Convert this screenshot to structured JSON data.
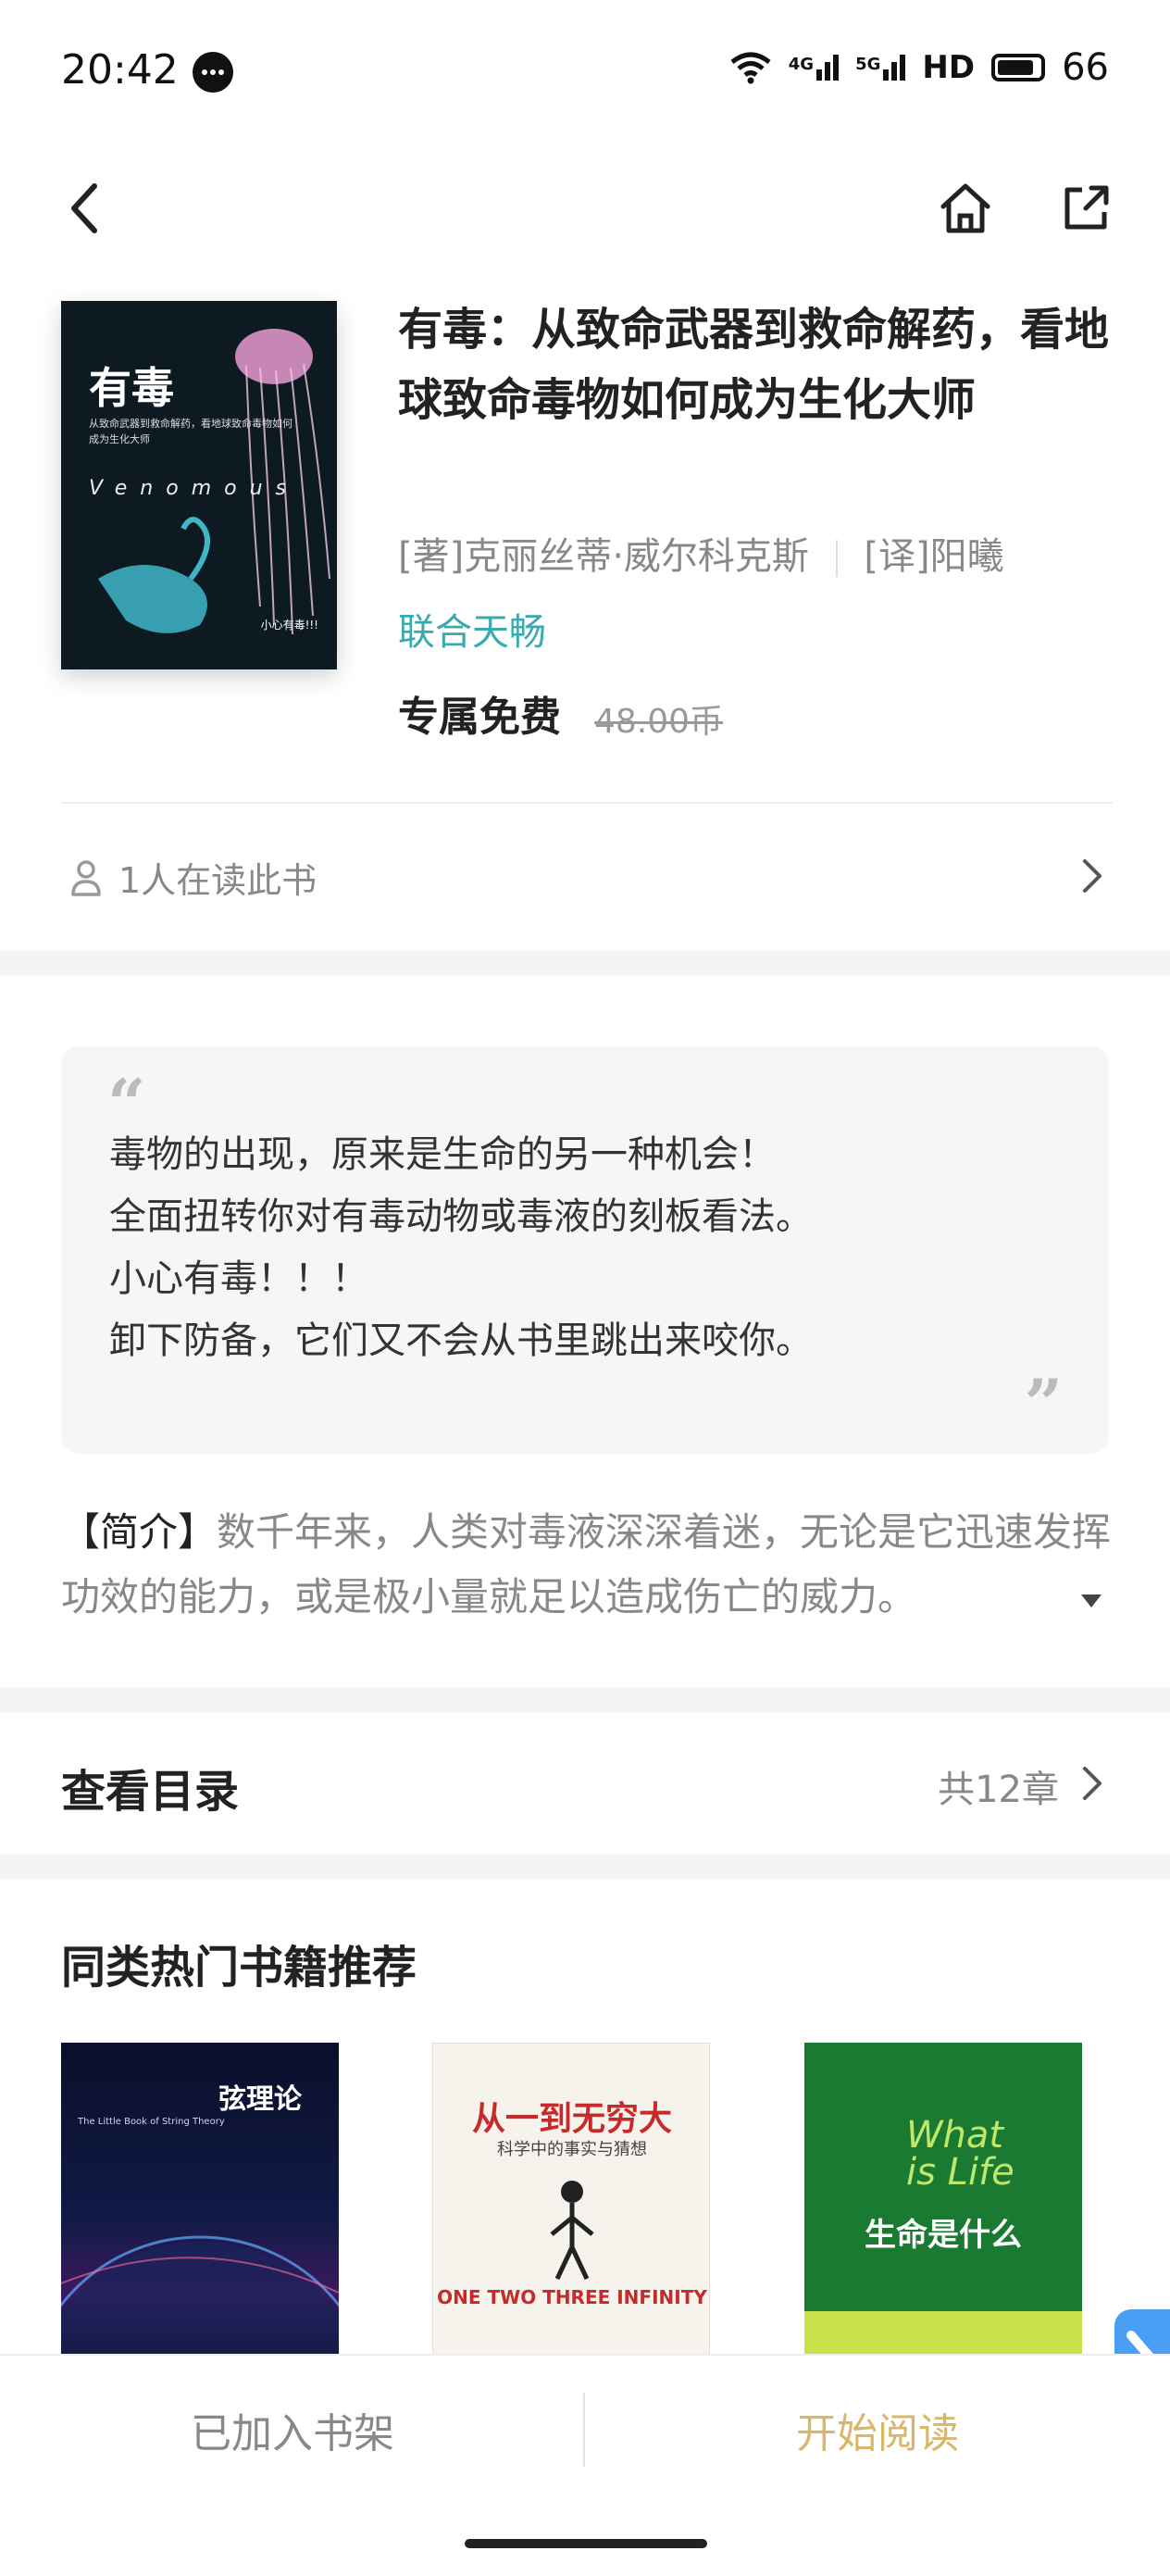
{
  "status_bar": {
    "time": "20:42",
    "network_1": "4G",
    "network_2": "5G",
    "hd": "HD",
    "battery": "66"
  },
  "nav": {
    "back_icon": "chevron-left-icon",
    "home_icon": "home-icon",
    "share_icon": "share-icon"
  },
  "book": {
    "cover": {
      "title": "有毒",
      "subtitle": "从致命武器到救命解药，看地球致命毒物如何成为生化大师",
      "latin": "Venomous",
      "note": "小心有毒!!!"
    },
    "title": "有毒：从致命武器到救命解药，看地球致命毒物如何成为生化大师",
    "author": "[著]克丽丝蒂·威尔科克斯",
    "translator": "[译]阳曦",
    "publisher": "联合天畅",
    "price_label": "专属免费",
    "original_price": "48.00币"
  },
  "readers": {
    "text": "1人在读此书"
  },
  "quote": {
    "open_mark": "“",
    "close_mark": "”",
    "lines": [
      "毒物的出现，原来是生命的另一种机会！",
      "全面扭转你对有毒动物或毒液的刻板看法。",
      "小心有毒！！！",
      "卸下防备，它们又不会从书里跳出来咬你。"
    ]
  },
  "intro": {
    "label": "【简介】",
    "text": "数千年来，人类对毒液深深着迷，无论是它迅速发挥功效的能力，或是极小量就足以造成伤亡的威力。"
  },
  "toc": {
    "title": "查看目录",
    "count": "共12章"
  },
  "recommend": {
    "title": "同类热门书籍推荐",
    "books": [
      {
        "cover_title": "弦理论",
        "cover_sub": "The Little Book of String Theory"
      },
      {
        "cover_title": "从一到无穷大",
        "cover_sub": "科学中的事实与猜想",
        "cover_en": "ONE TWO THREE INFINITY"
      },
      {
        "cover_title": "生命是什么",
        "cover_en": "What is Life"
      }
    ]
  },
  "bottom_bar": {
    "shelf_label": "已加入书架",
    "read_label": "开始阅读"
  },
  "colors": {
    "accent_teal": "#3aaab0",
    "read_gold": "#d8b66a",
    "float_blue": "#4a9ff5"
  }
}
